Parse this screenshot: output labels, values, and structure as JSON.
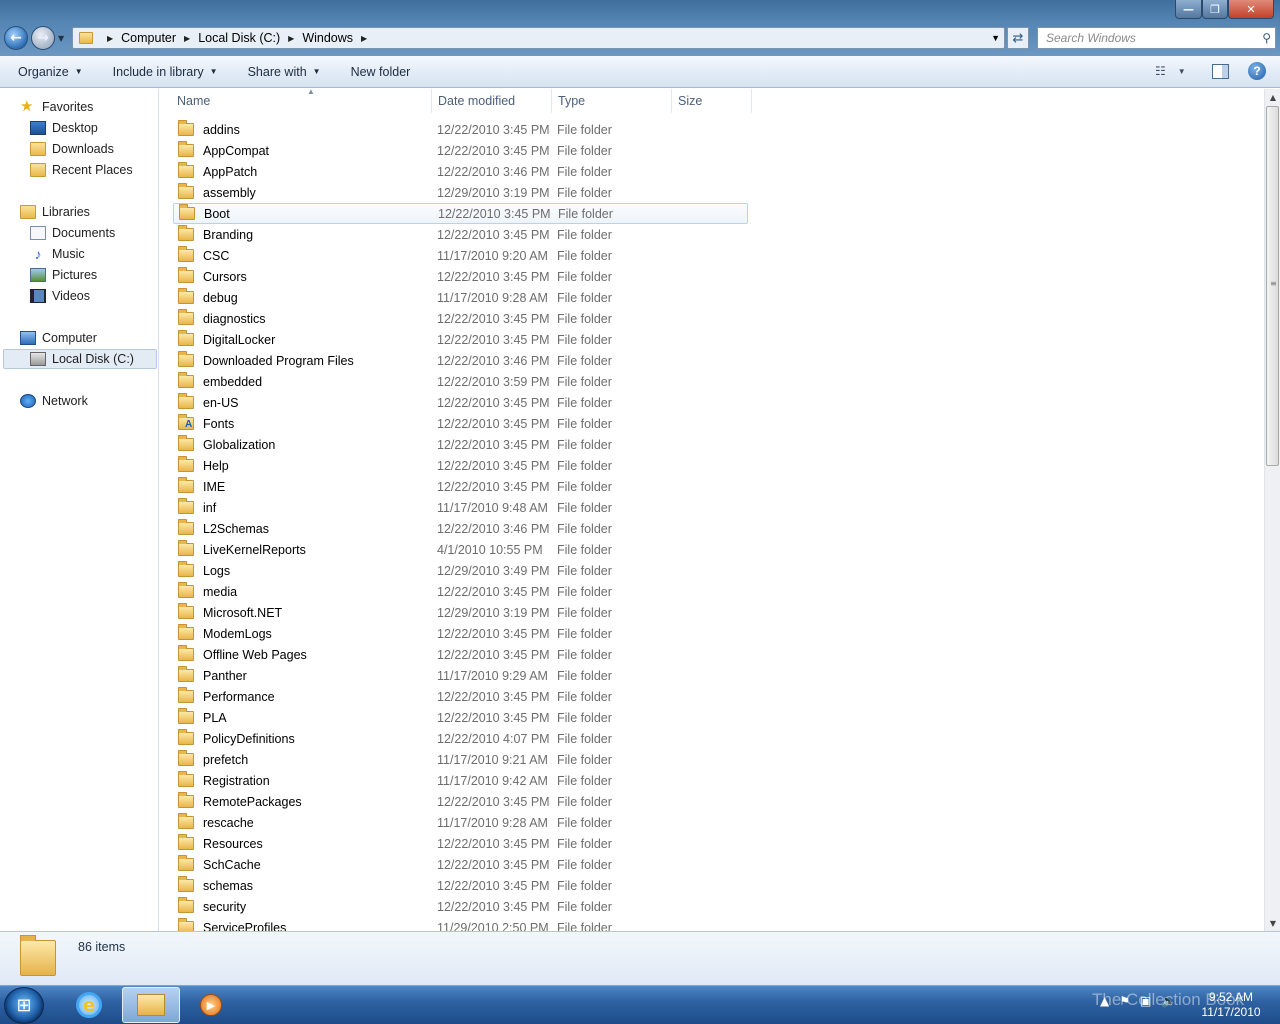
{
  "window": {
    "buttons": {
      "minimize": "—",
      "maximize": "❐",
      "close": "✕"
    }
  },
  "address": {
    "crumbs": [
      "Computer",
      "Local Disk (C:)",
      "Windows"
    ]
  },
  "search": {
    "placeholder": "Search Windows"
  },
  "toolbar": {
    "organize": "Organize",
    "include_in_library": "Include in library",
    "share_with": "Share with",
    "new_folder": "New folder",
    "help": "?"
  },
  "nav": {
    "favorites": "Favorites",
    "desktop": "Desktop",
    "downloads": "Downloads",
    "recent_places": "Recent Places",
    "libraries": "Libraries",
    "documents": "Documents",
    "music": "Music",
    "pictures": "Pictures",
    "videos": "Videos",
    "computer": "Computer",
    "local_disk": "Local Disk (C:)",
    "network": "Network"
  },
  "columns": {
    "name": "Name",
    "date": "Date modified",
    "type": "Type",
    "size": "Size"
  },
  "files": [
    {
      "name": "addins",
      "date": "12/22/2010 3:45 PM",
      "type": "File folder"
    },
    {
      "name": "AppCompat",
      "date": "12/22/2010 3:45 PM",
      "type": "File folder"
    },
    {
      "name": "AppPatch",
      "date": "12/22/2010 3:46 PM",
      "type": "File folder"
    },
    {
      "name": "assembly",
      "date": "12/29/2010 3:19 PM",
      "type": "File folder"
    },
    {
      "name": "Boot",
      "date": "12/22/2010 3:45 PM",
      "type": "File folder"
    },
    {
      "name": "Branding",
      "date": "12/22/2010 3:45 PM",
      "type": "File folder"
    },
    {
      "name": "CSC",
      "date": "11/17/2010 9:20 AM",
      "type": "File folder"
    },
    {
      "name": "Cursors",
      "date": "12/22/2010 3:45 PM",
      "type": "File folder"
    },
    {
      "name": "debug",
      "date": "11/17/2010 9:28 AM",
      "type": "File folder"
    },
    {
      "name": "diagnostics",
      "date": "12/22/2010 3:45 PM",
      "type": "File folder"
    },
    {
      "name": "DigitalLocker",
      "date": "12/22/2010 3:45 PM",
      "type": "File folder"
    },
    {
      "name": "Downloaded Program Files",
      "date": "12/22/2010 3:46 PM",
      "type": "File folder"
    },
    {
      "name": "embedded",
      "date": "12/22/2010 3:59 PM",
      "type": "File folder"
    },
    {
      "name": "en-US",
      "date": "12/22/2010 3:45 PM",
      "type": "File folder"
    },
    {
      "name": "Fonts",
      "date": "12/22/2010 3:45 PM",
      "type": "File folder"
    },
    {
      "name": "Globalization",
      "date": "12/22/2010 3:45 PM",
      "type": "File folder"
    },
    {
      "name": "Help",
      "date": "12/22/2010 3:45 PM",
      "type": "File folder"
    },
    {
      "name": "IME",
      "date": "12/22/2010 3:45 PM",
      "type": "File folder"
    },
    {
      "name": "inf",
      "date": "11/17/2010 9:48 AM",
      "type": "File folder"
    },
    {
      "name": "L2Schemas",
      "date": "12/22/2010 3:46 PM",
      "type": "File folder"
    },
    {
      "name": "LiveKernelReports",
      "date": "4/1/2010 10:55 PM",
      "type": "File folder"
    },
    {
      "name": "Logs",
      "date": "12/29/2010 3:49 PM",
      "type": "File folder"
    },
    {
      "name": "media",
      "date": "12/22/2010 3:45 PM",
      "type": "File folder"
    },
    {
      "name": "Microsoft.NET",
      "date": "12/29/2010 3:19 PM",
      "type": "File folder"
    },
    {
      "name": "ModemLogs",
      "date": "12/22/2010 3:45 PM",
      "type": "File folder"
    },
    {
      "name": "Offline Web Pages",
      "date": "12/22/2010 3:45 PM",
      "type": "File folder"
    },
    {
      "name": "Panther",
      "date": "11/17/2010 9:29 AM",
      "type": "File folder"
    },
    {
      "name": "Performance",
      "date": "12/22/2010 3:45 PM",
      "type": "File folder"
    },
    {
      "name": "PLA",
      "date": "12/22/2010 3:45 PM",
      "type": "File folder"
    },
    {
      "name": "PolicyDefinitions",
      "date": "12/22/2010 4:07 PM",
      "type": "File folder"
    },
    {
      "name": "prefetch",
      "date": "11/17/2010 9:21 AM",
      "type": "File folder"
    },
    {
      "name": "Registration",
      "date": "11/17/2010 9:42 AM",
      "type": "File folder"
    },
    {
      "name": "RemotePackages",
      "date": "12/22/2010 3:45 PM",
      "type": "File folder"
    },
    {
      "name": "rescache",
      "date": "11/17/2010 9:28 AM",
      "type": "File folder"
    },
    {
      "name": "Resources",
      "date": "12/22/2010 3:45 PM",
      "type": "File folder"
    },
    {
      "name": "SchCache",
      "date": "12/22/2010 3:45 PM",
      "type": "File folder"
    },
    {
      "name": "schemas",
      "date": "12/22/2010 3:45 PM",
      "type": "File folder"
    },
    {
      "name": "security",
      "date": "12/22/2010 3:45 PM",
      "type": "File folder"
    },
    {
      "name": "ServiceProfiles",
      "date": "11/29/2010 2:50 PM",
      "type": "File folder"
    }
  ],
  "hovered_file": "Boot",
  "status": {
    "item_count": "86 items"
  },
  "taskbar": {
    "time": "9:52 AM",
    "date": "11/17/2010",
    "watermark": "The Collection Book"
  },
  "colors": {
    "title_gradient": "#5585b3",
    "taskbar": "#2f62a2",
    "hover_border": "#b9d1ea",
    "secondary_text": "#6d6d6d"
  }
}
